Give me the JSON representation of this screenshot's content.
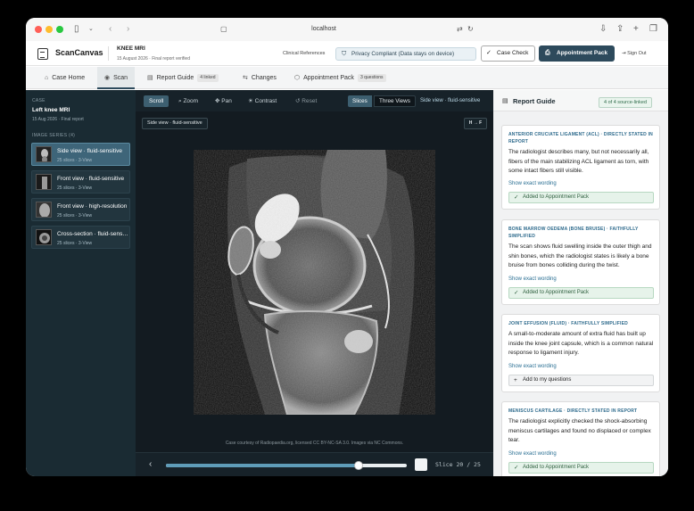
{
  "browser": {
    "url": "localhost"
  },
  "header": {
    "brand": "ScanCanvas",
    "study_title": "KNEE MRI",
    "study_subtitle": "15 August 2026 · Final report verified",
    "clinical_references": "Clinical References",
    "privacy": "Privacy Compliant (Data stays on device)",
    "case_check": "Case Check",
    "appointment_pack": "Appointment Pack",
    "sign_out": "Sign Out"
  },
  "tabs": [
    {
      "label": "Case Home",
      "badge": ""
    },
    {
      "label": "Scan",
      "badge": ""
    },
    {
      "label": "Report Guide",
      "badge": "4 linked"
    },
    {
      "label": "Changes",
      "badge": ""
    },
    {
      "label": "Appointment Pack",
      "badge": "3 questions"
    }
  ],
  "sidebar": {
    "case_label": "CASE",
    "case_title": "Left knee MRI",
    "case_sub": "15 Aug 2026 · Final report",
    "series_label": "IMAGE SERIES (4)",
    "series": [
      {
        "title": "Side view · fluid-sensitive",
        "sub": "25 slices · 3-View"
      },
      {
        "title": "Front view · fluid-sensitive",
        "sub": "25 slices · 3-View"
      },
      {
        "title": "Front view · high-resolution",
        "sub": "25 slices · 3-View"
      },
      {
        "title": "Cross-section · fluid-sensitive",
        "sub": "25 slices · 3-View"
      }
    ]
  },
  "viewer": {
    "tools": {
      "scroll": "Scroll",
      "zoom": "Zoom",
      "pan": "Pan",
      "contrast": "Contrast",
      "reset": "Reset"
    },
    "mode_slices": "Slices",
    "mode_three": "Three Views",
    "current_series": "Side view · fluid-sensitive",
    "image_label": "Side view · fluid-sensitive",
    "orientation": "H → F",
    "credit": "Case courtesy of Radiopaedia.org, licensed CC BY-NC-SA 3.0. Images via NC Commons.",
    "slice_text": "Slice 20 / 25",
    "slice_fraction": 0.8
  },
  "guide": {
    "title": "Report Guide",
    "count": "4 of 4 source-linked",
    "cards": [
      {
        "label": "ANTERIOR CRUCIATE LIGAMENT (ACL) · DIRECTLY STATED IN REPORT",
        "body": "The radiologist describes many, but not necessarily all, fibers of the main stabilizing ACL ligament as torn, with some intact fibers still visible.",
        "link": "Show exact wording",
        "button": "Added to Appointment Pack"
      },
      {
        "label": "BONE MARROW OEDEMA (BONE BRUISE) · FAITHFULLY SIMPLIFIED",
        "body": "The scan shows fluid swelling inside the outer thigh and shin bones, which the radiologist states is likely a bone bruise from bones colliding during the twist.",
        "link": "Show exact wording",
        "button": "Added to Appointment Pack"
      },
      {
        "label": "JOINT EFFUSION (FLUID) · FAITHFULLY SIMPLIFIED",
        "body": "A small-to-moderate amount of extra fluid has built up inside the knee joint capsule, which is a common natural response to ligament injury.",
        "link": "Show exact wording",
        "button": "Add to my questions"
      },
      {
        "label": "MENISCUS CARTILAGE · DIRECTLY STATED IN REPORT",
        "body": "The radiologist explicitly checked the shock-absorbing meniscus cartilages and found no displaced or complex tear.",
        "link": "Show exact wording",
        "button": "Added to Appointment Pack"
      }
    ]
  }
}
